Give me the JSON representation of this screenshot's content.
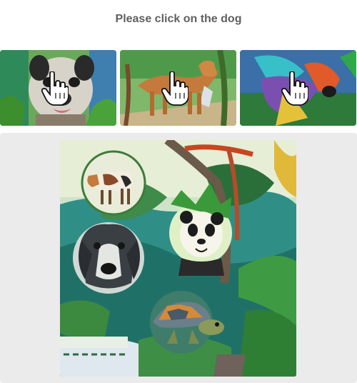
{
  "prompt": {
    "text": "Please click on the dog"
  },
  "examples": [
    {
      "subject": "dog",
      "icon": "pointing-hand-cursor-icon"
    },
    {
      "subject": "dog",
      "icon": "pointing-hand-cursor-icon"
    },
    {
      "subject": "dog",
      "icon": "pointing-hand-cursor-icon"
    }
  ],
  "scene": {
    "objects": [
      "cow",
      "panda",
      "dog",
      "turtle"
    ]
  },
  "colors": {
    "prompt_text": "#606060",
    "panel_background": "#ebebeb",
    "page_background": "#ffffff"
  }
}
